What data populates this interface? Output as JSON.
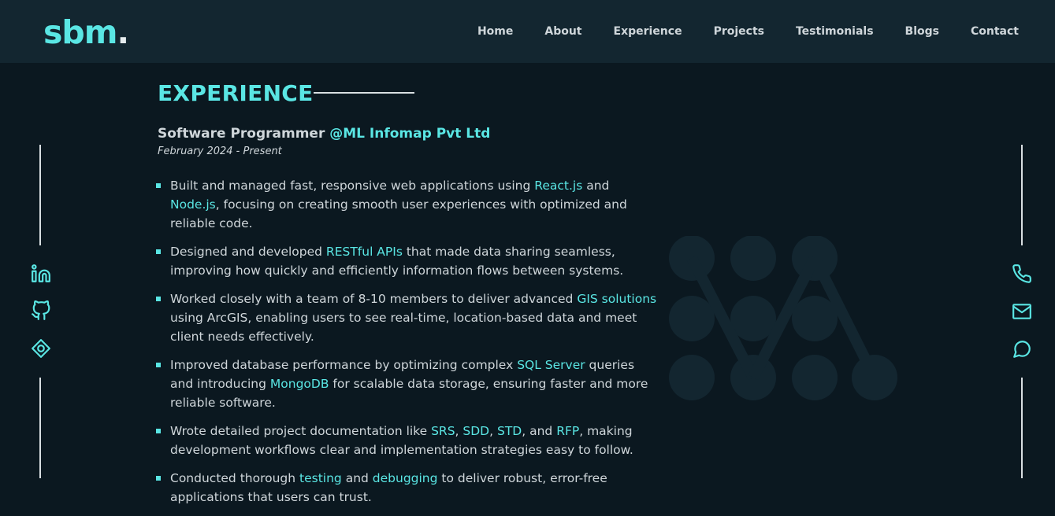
{
  "header": {
    "logo_text": "sbm",
    "logo_dot": ".",
    "nav": [
      "Home",
      "About",
      "Experience",
      "Projects",
      "Testimonials",
      "Blogs",
      "Contact"
    ]
  },
  "left_icons": [
    "linkedin-icon",
    "github-icon",
    "location-icon"
  ],
  "right_icons": [
    "phone-icon",
    "mail-icon",
    "chat-icon"
  ],
  "colors": {
    "accent": "#5ae6e4",
    "background": "#0b1820",
    "header": "#132630",
    "text": "#cfd6da"
  },
  "section": {
    "title": "EXPERIENCE"
  },
  "job": {
    "role": "Software Programmer",
    "company": "@ML Infomap Pvt Ltd",
    "date": "February 2024 - Present",
    "bullets": [
      [
        {
          "t": "Built and managed fast, responsive web applications using "
        },
        {
          "t": "React.js",
          "hl": true
        },
        {
          "t": " and "
        },
        {
          "t": "Node.js",
          "hl": true
        },
        {
          "t": ", focusing on creating smooth user experiences with optimized and reliable code."
        }
      ],
      [
        {
          "t": "Designed and developed "
        },
        {
          "t": "RESTful APIs",
          "hl": true
        },
        {
          "t": " that made data sharing seamless, improving how quickly and efficiently information flows between systems."
        }
      ],
      [
        {
          "t": "Worked closely with a team of 8-10 members to deliver advanced "
        },
        {
          "t": "GIS solutions",
          "hl": true
        },
        {
          "t": " using ArcGIS, enabling users to see real-time, location-based data and meet client needs effectively."
        }
      ],
      [
        {
          "t": "Improved database performance by optimizing complex "
        },
        {
          "t": "SQL Server",
          "hl": true
        },
        {
          "t": " queries and introducing "
        },
        {
          "t": "MongoDB",
          "hl": true
        },
        {
          "t": " for scalable data storage, ensuring faster and more reliable software."
        }
      ],
      [
        {
          "t": "Wrote detailed project documentation like "
        },
        {
          "t": "SRS",
          "hl": true
        },
        {
          "t": ", "
        },
        {
          "t": "SDD",
          "hl": true
        },
        {
          "t": ", "
        },
        {
          "t": "STD",
          "hl": true
        },
        {
          "t": ", and "
        },
        {
          "t": "RFP",
          "hl": true
        },
        {
          "t": ", making development workflows clear and implementation strategies easy to follow."
        }
      ],
      [
        {
          "t": "Conducted thorough "
        },
        {
          "t": "testing",
          "hl": true
        },
        {
          "t": " and "
        },
        {
          "t": "debugging",
          "hl": true
        },
        {
          "t": " to deliver robust, error-free applications that users can trust."
        }
      ]
    ]
  }
}
